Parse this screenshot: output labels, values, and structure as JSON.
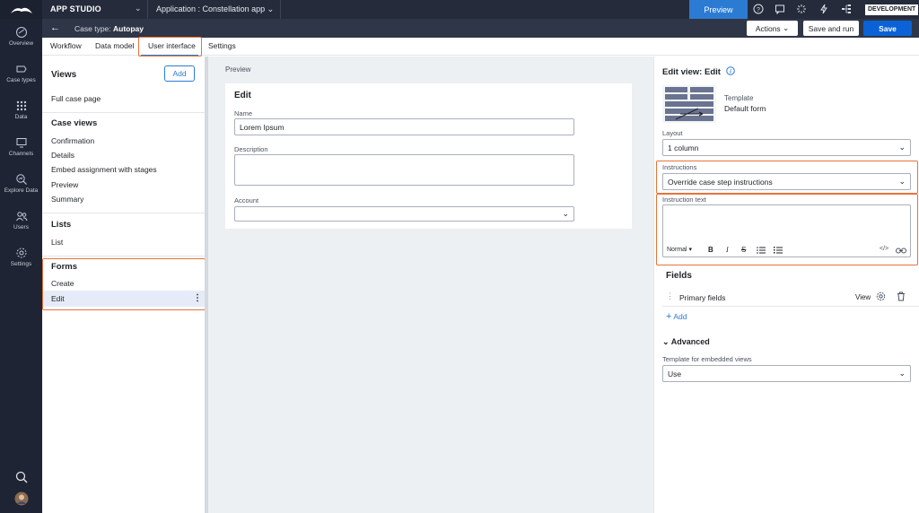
{
  "topbar": {
    "studio": "APP STUDIO",
    "application_label": "Application :",
    "application_value": "Constellation app",
    "preview": "Preview",
    "environment": "DEVELOPMENT",
    "icons": [
      "help-icon",
      "chat-icon",
      "spinner-icon",
      "flash-icon",
      "tree-icon"
    ]
  },
  "subbar": {
    "case_type_label": "Case type:",
    "case_type_value": "Autopay",
    "actions": "Actions",
    "save_and_run": "Save and run",
    "save": "Save"
  },
  "rail": {
    "items": [
      {
        "label": "Overview",
        "icon": "overview-icon"
      },
      {
        "label": "Case types",
        "icon": "case-types-icon"
      },
      {
        "label": "Data",
        "icon": "data-icon"
      },
      {
        "label": "Channels",
        "icon": "channels-icon"
      },
      {
        "label": "Explore Data",
        "icon": "explore-data-icon"
      },
      {
        "label": "Users",
        "icon": "users-icon"
      },
      {
        "label": "Settings",
        "icon": "settings-icon"
      }
    ]
  },
  "tabs": [
    "Workflow",
    "Data model",
    "User interface",
    "Settings"
  ],
  "views": {
    "title": "Views",
    "add": "Add",
    "full_case_page": "Full case page",
    "case_views_title": "Case views",
    "case_views": [
      "Confirmation",
      "Details",
      "Embed assignment with stages",
      "Preview",
      "Summary"
    ],
    "lists_title": "Lists",
    "lists": [
      "List"
    ],
    "forms_title": "Forms",
    "forms": [
      "Create",
      "Edit"
    ]
  },
  "preview": {
    "heading": "Preview",
    "card_title": "Edit",
    "name_label": "Name",
    "name_value": "Lorem Ipsum",
    "description_label": "Description",
    "account_label": "Account"
  },
  "right": {
    "title": "Edit view: Edit",
    "template_label": "Template",
    "template_value": "Default form",
    "layout_label": "Layout",
    "layout_value": "1 column",
    "instructions_label": "Instructions",
    "instructions_value": "Override case step instructions",
    "instruction_text_label": "Instruction text",
    "rte_style": "Normal",
    "fields_title": "Fields",
    "primary_fields": "Primary fields",
    "view_link": "View",
    "add_link": "Add",
    "advanced_title": "Advanced",
    "embedded_label": "Template for embedded views",
    "embedded_value": "Use"
  },
  "colors": {
    "accent": "#2b7bd3",
    "save_button": "#0b62d6",
    "highlight": "#e8733a",
    "selected_row": "#e6ecf7",
    "rail_bg": "#1e2433"
  }
}
